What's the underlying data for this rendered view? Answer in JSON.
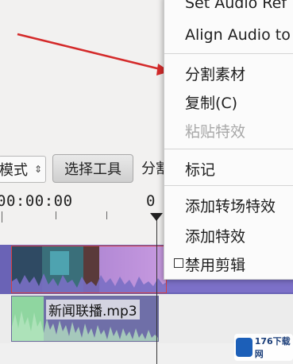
{
  "toolbar": {
    "mode_select_value": "模式",
    "select_tool_label": "选择工具",
    "split_tool_label": "分割"
  },
  "ruler": {
    "timecode_start": "00:00:00",
    "timecode_next": "0"
  },
  "tracks": {
    "audio_clip_label": "新闻联播.mp3"
  },
  "context_menu": {
    "items": [
      {
        "label": "Set Audio Ref",
        "enabled": true
      },
      {
        "label": "Align Audio to",
        "enabled": true
      },
      {
        "label": "分割素材",
        "enabled": true
      },
      {
        "label": "复制(C)",
        "enabled": true
      },
      {
        "label": "粘贴特效",
        "enabled": false
      },
      {
        "label": "标记",
        "enabled": true
      },
      {
        "label": "添加转场特效",
        "enabled": true
      },
      {
        "label": "添加特效",
        "enabled": true
      },
      {
        "label": "禁用剪辑",
        "enabled": true,
        "checkbox": true,
        "checked": false
      }
    ]
  },
  "watermark": {
    "text": "176下载网"
  },
  "colors": {
    "annotation_arrow": "#d42a2a",
    "clip_border_selected": "#d64040",
    "video_track": "#6a63b6",
    "audio_waveform": "#8fd6a0"
  }
}
